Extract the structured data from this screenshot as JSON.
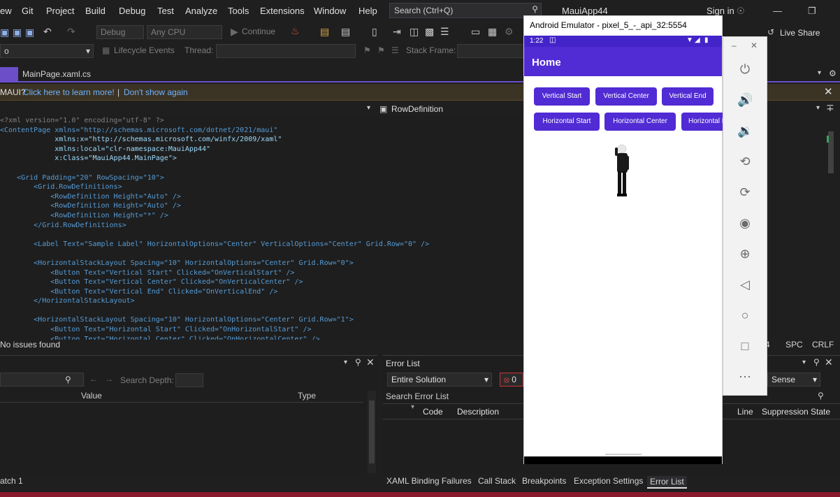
{
  "menubar": {
    "items": [
      "ew",
      "Git",
      "Project",
      "Build",
      "Debug",
      "Test",
      "Analyze",
      "Tools",
      "Extensions",
      "Window",
      "Help"
    ],
    "search_placeholder": "Search (Ctrl+Q)",
    "solution_name": "MauiApp44",
    "signin": "Sign in"
  },
  "toolbar": {
    "config": "Debug",
    "platform": "Any CPU",
    "continue": "Continue",
    "live_share": "Live Share"
  },
  "toolbar2": {
    "lifecycle": "Lifecycle Events",
    "thread_label": "Thread:",
    "stack_frame": "Stack Frame:",
    "dropdown_left": "o"
  },
  "tabs": {
    "active": "MainPage.xaml.cs"
  },
  "infobar": {
    "prefix": "MAUI?",
    "learn_more": "Click here to learn more!",
    "separator": "|",
    "dont_show": "Don't show again"
  },
  "navbar": {
    "element": "RowDefinition"
  },
  "editor_status": {
    "issues": "No issues found",
    "pos": "4",
    "spc": "SPC",
    "crlf": "CRLF"
  },
  "watch_panel": {
    "search_depth": "Search Depth:",
    "col_value": "Value",
    "col_type": "Type",
    "tab": "atch 1"
  },
  "error_panel": {
    "title": "Error List",
    "scope": "Entire Solution",
    "error_count": "0",
    "search": "Search Error List",
    "col_code": "Code",
    "col_description": "Description",
    "col_line": "Line",
    "col_suppression": "Suppression State",
    "intellisense": "Sense"
  },
  "bottom_tabs": [
    "XAML Binding Failures",
    "Call Stack",
    "Breakpoints",
    "Exception Settings",
    "Error List"
  ],
  "emulator": {
    "title": "Android Emulator - pixel_5_-_api_32:5554",
    "time": "1:22",
    "app_title": "Home",
    "buttons_row1": [
      "Vertical Start",
      "Vertical Center",
      "Vertical End"
    ],
    "buttons_row2": [
      "Horizontal Start",
      "Horizontal Center",
      "Horizontal End"
    ]
  },
  "side_icons": [
    "power-icon",
    "volume-up-icon",
    "volume-down-icon",
    "rotate-left-icon",
    "rotate-right-icon",
    "camera-icon",
    "zoom-icon",
    "back-icon",
    "home-icon",
    "overview-icon",
    "more-icon"
  ],
  "code_lines": [
    [
      "s",
      "<?xml version=\"1.0\" encoding=\"utf-8\" ?>"
    ],
    [
      "t",
      "<ContentPage xmlns=\"http://schemas.microsoft.com/dotnet/2021/maui\""
    ],
    [
      "a",
      "             xmlns:x=\"http://schemas.microsoft.com/winfx/2009/xaml\""
    ],
    [
      "a",
      "             xmlns:local=\"clr-namespace:MauiApp44\""
    ],
    [
      "a",
      "             x:Class=\"MauiApp44.MainPage\">"
    ],
    [
      "s",
      ""
    ],
    [
      "t",
      "    <Grid Padding=\"20\" RowSpacing=\"10\">"
    ],
    [
      "t",
      "        <Grid.RowDefinitions>"
    ],
    [
      "t",
      "            <RowDefinition Height=\"Auto\" />"
    ],
    [
      "t",
      "            <RowDefinition Height=\"Auto\" />"
    ],
    [
      "t",
      "            <RowDefinition Height=\"*\" />"
    ],
    [
      "t",
      "        </Grid.RowDefinitions>"
    ],
    [
      "s",
      ""
    ],
    [
      "t",
      "        <Label Text=\"Sample Label\" HorizontalOptions=\"Center\" VerticalOptions=\"Center\" Grid.Row=\"0\" />"
    ],
    [
      "s",
      ""
    ],
    [
      "t",
      "        <HorizontalStackLayout Spacing=\"10\" HorizontalOptions=\"Center\" Grid.Row=\"0\">"
    ],
    [
      "t",
      "            <Button Text=\"Vertical Start\" Clicked=\"OnVerticalStart\" />"
    ],
    [
      "t",
      "            <Button Text=\"Vertical Center\" Clicked=\"OnVerticalCenter\" />"
    ],
    [
      "t",
      "            <Button Text=\"Vertical End\" Clicked=\"OnVerticalEnd\" />"
    ],
    [
      "t",
      "        </HorizontalStackLayout>"
    ],
    [
      "s",
      ""
    ],
    [
      "t",
      "        <HorizontalStackLayout Spacing=\"10\" HorizontalOptions=\"Center\" Grid.Row=\"1\">"
    ],
    [
      "t",
      "            <Button Text=\"Horizontal Start\" Clicked=\"OnHorizontalStart\" />"
    ],
    [
      "t",
      "            <Button Text=\"Horizontal Center\" Clicked=\"OnHorizontalCenter\" />"
    ]
  ]
}
